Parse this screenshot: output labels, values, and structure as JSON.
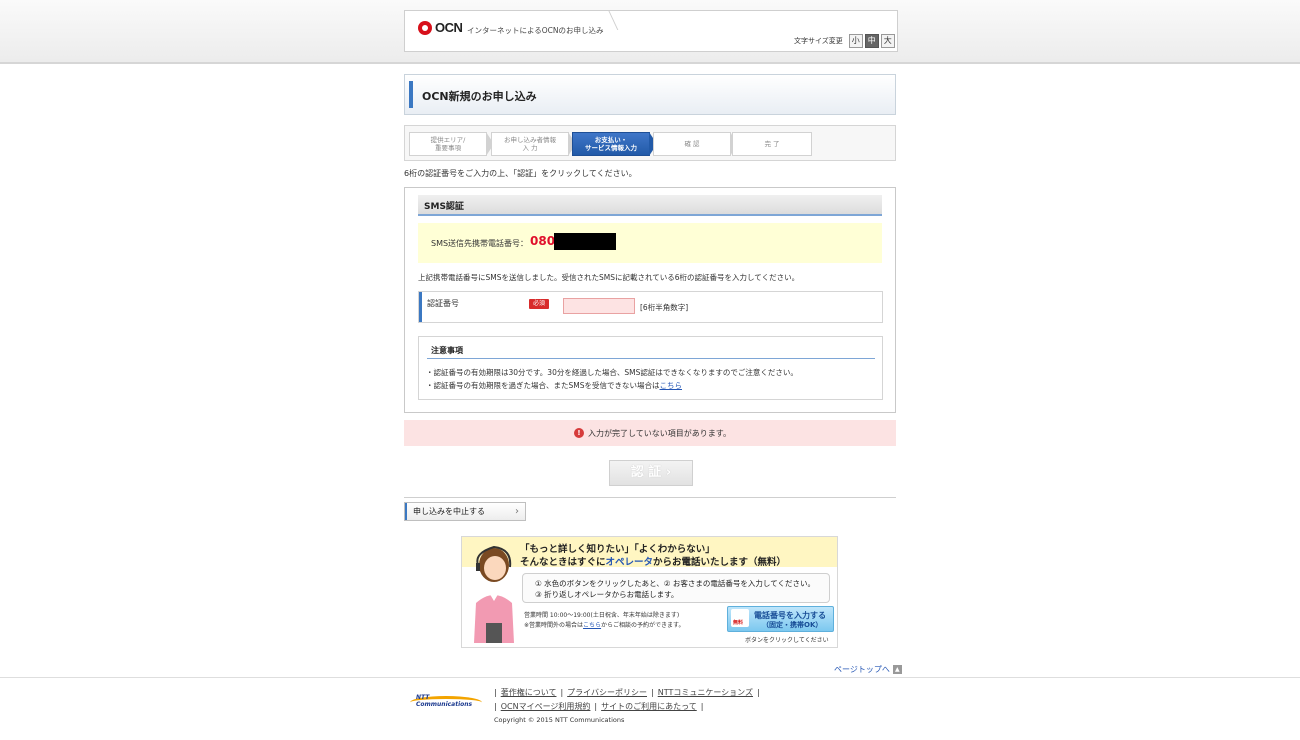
{
  "header": {
    "logo_text": "OCN",
    "description": "インターネットによるOCNのお申し込み",
    "font_size_label": "文字サイズ変更",
    "font_sizes": [
      "小",
      "中",
      "大"
    ]
  },
  "page_title": "OCN新規のお申し込み",
  "steps": [
    {
      "line1": "提供エリア/",
      "line2": "重要事項"
    },
    {
      "line1": "お申し込み者情報",
      "line2": "入 力"
    },
    {
      "line1": "お支払い・",
      "line2": "サービス情報入力"
    },
    {
      "line1": "確 認",
      "line2": ""
    },
    {
      "line1": "完 了",
      "line2": ""
    }
  ],
  "instruction": "6桁の認証番号をご入力の上、「認証」をクリックしてください。",
  "sms": {
    "heading": "SMS認証",
    "phone_label": "SMS送信先携帯電話番号：",
    "phone_prefix": "080-",
    "sent_message": "上記携帯電話番号にSMSを送信しました。受信されたSMSに記載されている6桁の認証番号を入力してください。",
    "field_label": "認証番号",
    "required_badge": "必須",
    "code_value": "",
    "field_hint": "[6桁半角数字]"
  },
  "notice": {
    "title": "注意事項",
    "line1": "・認証番号の有効期限は30分です。30分を経過した場合、SMS認証はできなくなりますのでご注意ください。",
    "line2_pre": "・認証番号の有効期限を過ぎた場合、またSMSを受信できない場合は",
    "line2_link": "こちら"
  },
  "error": {
    "icon": "!",
    "message": "入力が完了していない項目があります。"
  },
  "auth_button": "認 証 ›",
  "cancel_button": "申し込みを中止する",
  "operator": {
    "head1": "「もっと詳しく知りたい」「よくわからない」",
    "head2_pre": "そんなときはすぐに",
    "head2_hl": "オペレータ",
    "head2_post": "からお電話いたします（無料）",
    "step1": "① 水色のボタンをクリックしたあと、② お客さまの電話番号を入力してください。",
    "step2": "③ 折り返しオペレータからお電話します。",
    "hours1": "営業時間 10:00〜19:00(土日祝含、年末年始は除きます)",
    "hours2_pre": "※営業時間外の場合は",
    "hours2_link": "こちら",
    "hours2_post": "からご相談の予約ができます。",
    "call_badge": "無料",
    "call_line1": "電話番号を入力する",
    "call_line2": "（固定・携帯OK）",
    "call_note": "ボタンをクリックしてください"
  },
  "page_top": "ページトップへ",
  "footer": {
    "logo_text": "NTT Communications",
    "links_row1": [
      "著作権について",
      "プライバシーポリシー",
      "NTTコミュニケーションズ"
    ],
    "links_row2": [
      "OCNマイページ利用規約",
      "サイトのご利用にあたって"
    ],
    "copyright": "Copyright © 2015  NTT Communications"
  }
}
